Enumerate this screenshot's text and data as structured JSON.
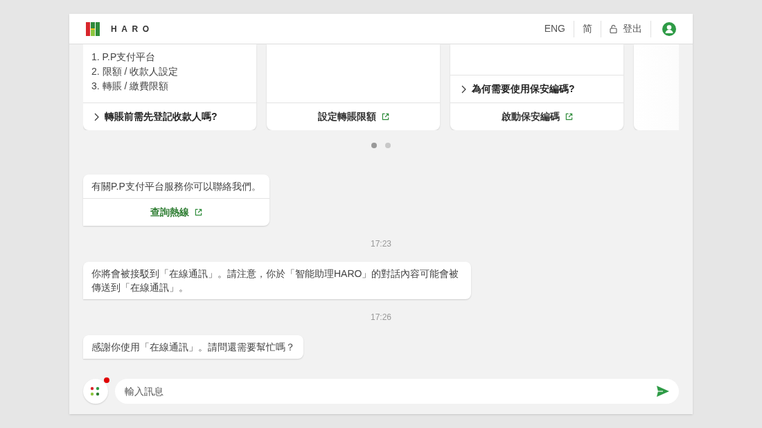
{
  "header": {
    "logo_text": "HARO",
    "links": [
      {
        "kind": "text",
        "label": "ENG"
      },
      {
        "kind": "text",
        "label": "简"
      },
      {
        "kind": "lock",
        "label": "登出"
      },
      {
        "kind": "avatar"
      }
    ]
  },
  "carousel": {
    "cards": [
      {
        "lines": [
          "1. P.P支付平台",
          "2. 限額 / 收款人設定",
          "3. 轉賬 / 繳費限額"
        ],
        "footers": [
          {
            "kind": "question",
            "text": "轉賬前需先登記收款人嗎?"
          }
        ]
      },
      {
        "footers": [
          {
            "kind": "link",
            "text": "設定轉賬限額"
          }
        ]
      },
      {
        "footers": [
          {
            "kind": "question",
            "text": "為何需要使用保安編碼?"
          },
          {
            "kind": "link",
            "text": "啟動保安編碼"
          }
        ]
      },
      {
        "faded": true
      }
    ],
    "dots": [
      {
        "selected": true
      },
      {
        "selected": false
      }
    ]
  },
  "messages": [
    {
      "kind": "bubble",
      "text": "有關P.P支付平台服務你可以聯絡我們。",
      "link": "查詢熱線"
    },
    {
      "kind": "time",
      "text": "17:23"
    },
    {
      "kind": "bubble",
      "text": "你將會被接駁到「在線通訊」。請注意，你於「智能助理HARO」的對話內容可能會被傳送到「在線通訊」。"
    },
    {
      "kind": "time",
      "text": "17:26"
    },
    {
      "kind": "bubble",
      "text": "感謝你使用「在線通訊」。請問還需要幫忙嗎？"
    }
  ],
  "input": {
    "placeholder": "輸入訊息",
    "notification": true
  }
}
